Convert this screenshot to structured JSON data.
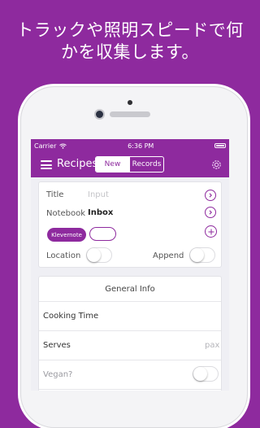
{
  "promo": {
    "line1": "トラックや照明スピードで何",
    "line2": "かを収集します。"
  },
  "status_bar": {
    "carrier": "Carrier",
    "time": "6:36 PM",
    "wifi_icon": "wifi-icon",
    "battery_icon": "battery-icon"
  },
  "nav": {
    "menu_icon": "hamburger-menu-icon",
    "title": "Recipes",
    "tabs": [
      {
        "label": "New",
        "selected": true
      },
      {
        "label": "Records",
        "selected": false
      }
    ],
    "settings_icon": "gear-icon"
  },
  "form": {
    "title_label": "Title",
    "title_placeholder": "Input",
    "notebook_label": "Notebook",
    "notebook_value": "Inbox",
    "tag_label": "Klevernote",
    "location_label": "Location",
    "location_on": false,
    "append_label": "Append",
    "append_on": false
  },
  "general_info": {
    "header": "General Info",
    "cooking_time_label": "Cooking Time",
    "serves_label": "Serves",
    "serves_unit": "pax",
    "vegan_label": "Vegan?",
    "vegan_on": false
  },
  "colors": {
    "brand": "#8e2a9e",
    "screen_bg": "#efeff4"
  }
}
